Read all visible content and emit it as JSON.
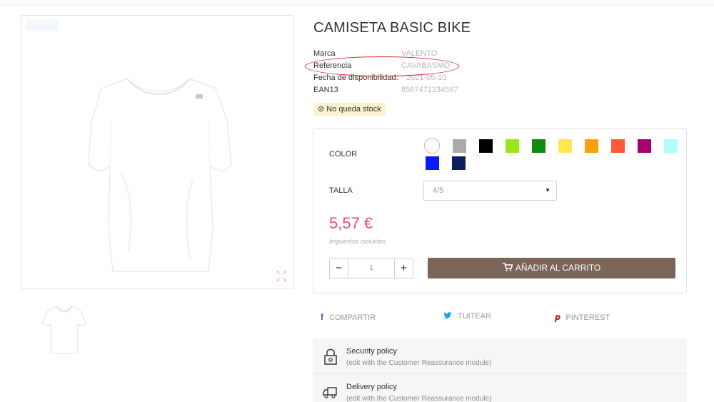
{
  "product": {
    "title": "CAMISETA BASIC BIKE",
    "info": [
      {
        "label": "Marca",
        "value": "VALENTO"
      },
      {
        "label": "Referencia",
        "value": "CAVABASMO"
      },
      {
        "label": "Fecha de disponibilidad:",
        "value": "2021-05-10"
      },
      {
        "label": "EAN13",
        "value": "8567471234567"
      }
    ],
    "stock_text": "No queda stock",
    "stock_icon": "ban-icon",
    "color_label": "COLOR",
    "colors": [
      "#ffffff",
      "#aaaaaa",
      "#000000",
      "#99e619",
      "#108a10",
      "#ffe84d",
      "#ff9f0a",
      "#ff5a36",
      "#a8006e",
      "#b0fff8",
      "#0a1cff",
      "#0c2060"
    ],
    "selected_color": "#ffffff",
    "size_label": "TALLA",
    "size_value": "4/5",
    "price": "5,57 €",
    "tax_note": "Impuestos incluidos",
    "quantity": "1",
    "cart_label": "AÑADIR AL CARRITO",
    "cart_icon": "cart-icon"
  },
  "share": [
    {
      "label": "COMPARTIR",
      "icon": "facebook-icon",
      "glyph": "f"
    },
    {
      "label": "TUITEAR",
      "icon": "twitter-icon",
      "glyph": "🐦"
    },
    {
      "label": "PINTEREST",
      "icon": "pinterest-icon",
      "glyph": "℗"
    }
  ],
  "reassurance": [
    {
      "title": "Security policy",
      "subtitle": "(edit with the Customer Reassurance module)",
      "icon": "lock-icon"
    },
    {
      "title": "Delivery policy",
      "subtitle": "(edit with the Customer Reassurance module)",
      "icon": "truck-icon"
    }
  ],
  "colors": {
    "accent_price": "#e74f6e",
    "cart_button": "#7a6558",
    "stock_badge": "#fcf2cf",
    "highlight": "#d8242a"
  }
}
